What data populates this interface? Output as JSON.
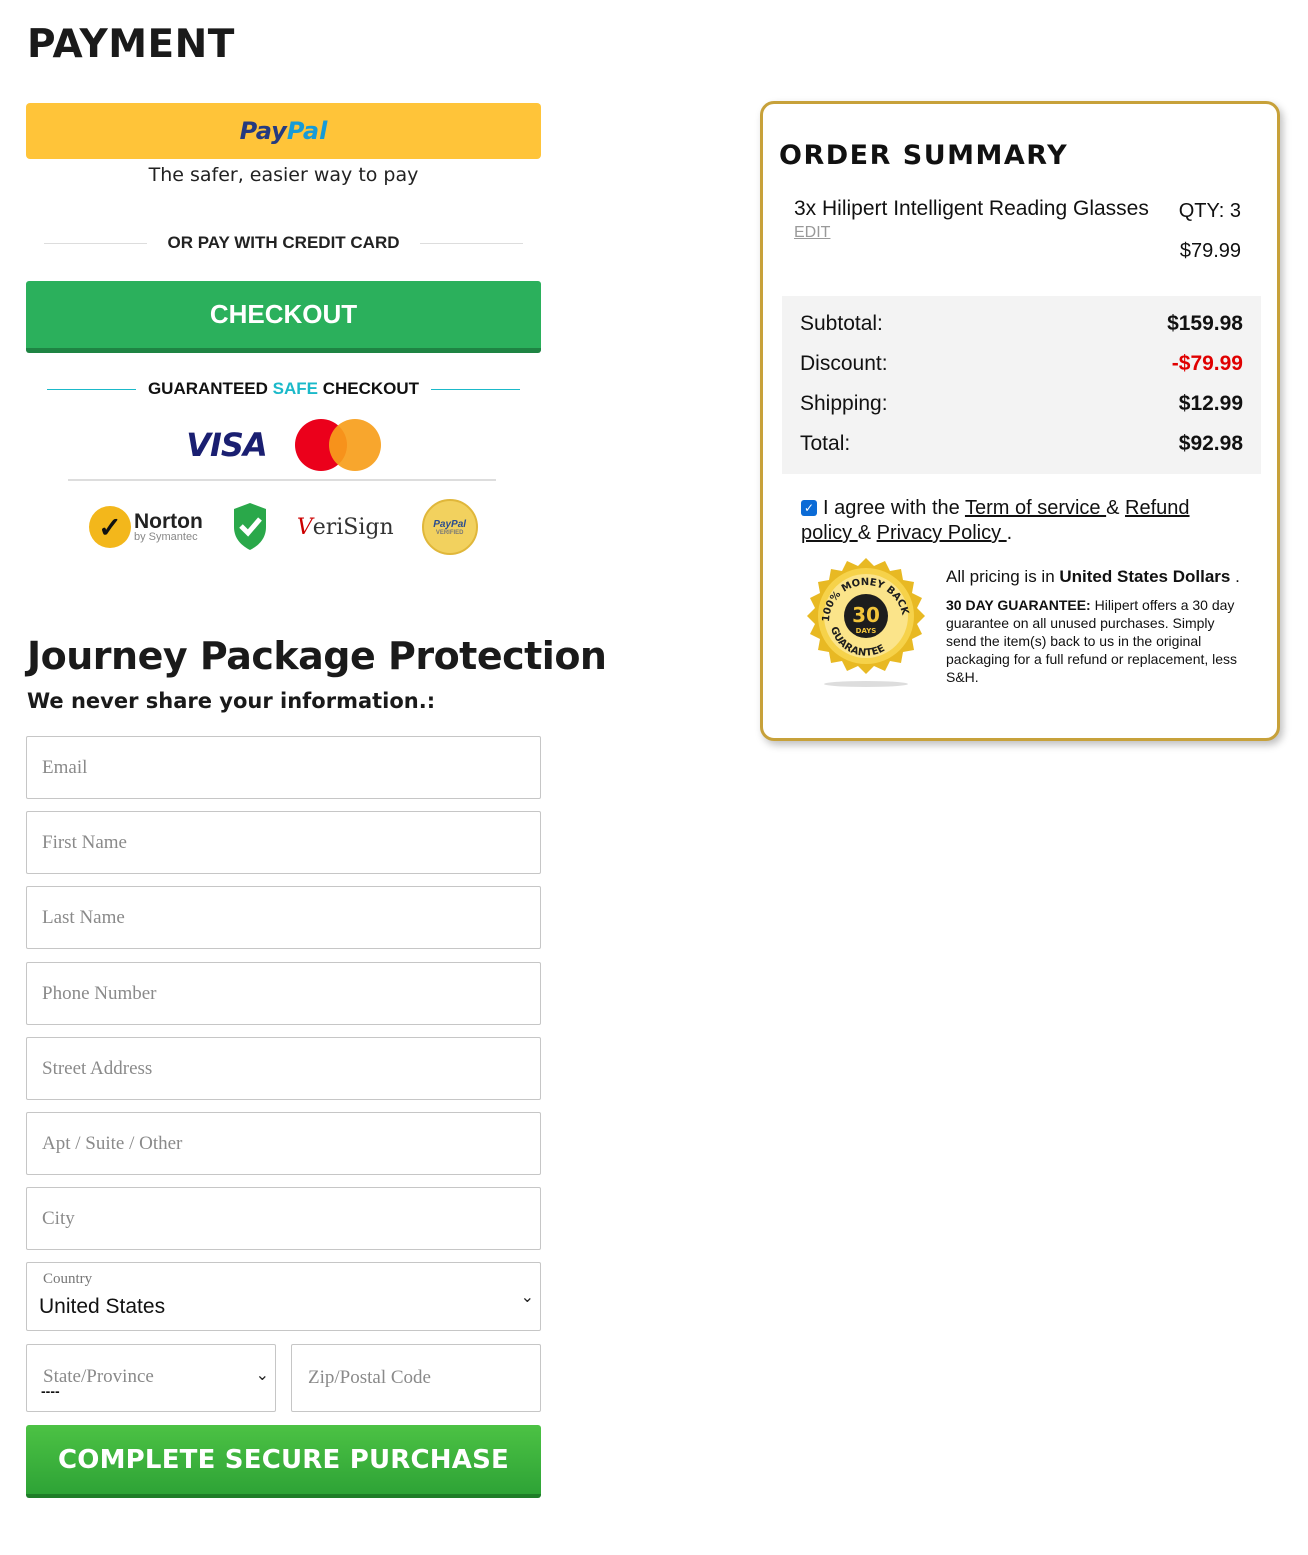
{
  "page": {
    "title": "PAYMENT"
  },
  "paypal": {
    "logo_part1": "Pay",
    "logo_part2": "Pal",
    "tagline": "The safer, easier way to pay"
  },
  "divider_text": "OR PAY WITH CREDIT CARD",
  "checkout_label": "CHECKOUT",
  "guaranteed": {
    "part1": "GUARANTEED ",
    "safe": "SAFE",
    "part2": " CHECKOUT"
  },
  "card_logos": {
    "visa": "VISA"
  },
  "badges": {
    "norton": "Norton",
    "norton_sub": "by Symantec",
    "verisign": "eriSign",
    "verisign_v": "V",
    "paypal_verified": "PayPal",
    "paypal_verified_sub": "VERIFIED"
  },
  "form": {
    "title": "Journey Package Protection",
    "subtitle": "We never share your information.:",
    "email_placeholder": "Email",
    "first_name_placeholder": "First Name",
    "last_name_placeholder": "Last Name",
    "phone_placeholder": "Phone Number",
    "street_placeholder": "Street Address",
    "apt_placeholder": "Apt / Suite / Other",
    "city_placeholder": "City",
    "country_label": "Country",
    "country_value": "United States",
    "state_placeholder": "State/Province",
    "state_value": "----",
    "zip_placeholder": "Zip/Postal Code",
    "submit_label": "COMPLETE SECURE PURCHASE"
  },
  "summary": {
    "title": "ORDER SUMMARY",
    "item_name": "3x Hilipert Intelligent Reading Glasses",
    "edit_label": "EDIT",
    "qty_label": "QTY: 3",
    "item_price": "$79.99",
    "subtotal_label": "Subtotal:",
    "subtotal_value": "$159.98",
    "discount_label": "Discount:",
    "discount_value": "-$79.99",
    "shipping_label": "Shipping:",
    "shipping_value": "$12.99",
    "total_label": "Total:",
    "total_value": "$92.98",
    "agree_text": "I agree with the ",
    "terms_link": "Term of service ",
    "amp1": "& ",
    "refund_link": "Refund policy ",
    "amp2": "& ",
    "privacy_link": "Privacy Policy ",
    "period": ".",
    "pricing_prefix": "All pricing is in ",
    "pricing_currency": "United States Dollars",
    "pricing_suffix": " .",
    "guarantee_title": "30 DAY GUARANTEE:",
    "guarantee_body": " Hilipert offers a 30 day guarantee on all unused purchases. Simply send the item(s) back to us in the original packaging for a full refund or replacement, less S&H.",
    "seal_top": "100% MONEY BACK",
    "seal_number": "30",
    "seal_days": "DAYS",
    "seal_bottom": "GUARANTEE"
  },
  "colors": {
    "paypal_yellow": "#ffc439",
    "checkout_green": "#2bb05c",
    "purchase_green": "#3cb53d",
    "summary_border": "#c7a13a",
    "discount_red": "#e00000",
    "safe_teal": "#1bb9c9"
  }
}
